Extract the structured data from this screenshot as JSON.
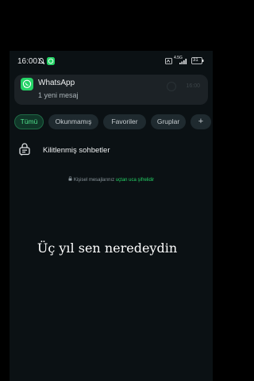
{
  "status_bar": {
    "time": "16:00",
    "network_label": "4.5G",
    "battery": "31"
  },
  "notification": {
    "app_name": "WhatsApp",
    "body": "1 yeni mesaj",
    "time": "16:00",
    "accent_color": "#25D366"
  },
  "filters": {
    "items": [
      {
        "label": "Tümü",
        "active": true
      },
      {
        "label": "Okunmamış",
        "active": false
      },
      {
        "label": "Favoriler",
        "active": false
      },
      {
        "label": "Gruplar",
        "active": false
      },
      {
        "label": "+",
        "active": false
      }
    ]
  },
  "locked_chats": {
    "label": "Kilitlenmiş sohbetler",
    "icon": "locked-chat-icon"
  },
  "encryption_note": {
    "prefix": "Kişisel mesajlarınız ",
    "link": "uçtan uca şifrelidir"
  },
  "caption": "Üç yıl sen neredeydin"
}
